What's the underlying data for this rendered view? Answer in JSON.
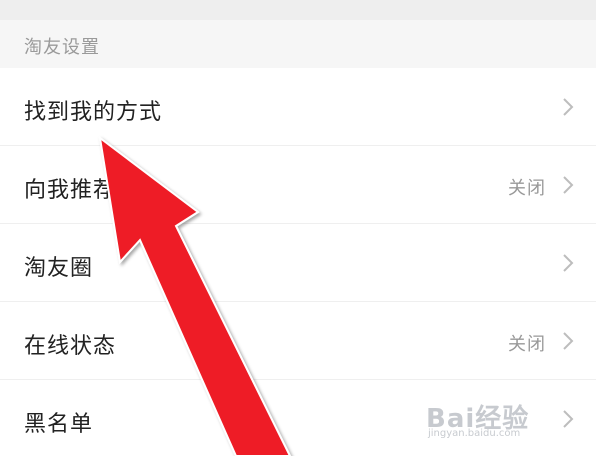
{
  "section": {
    "title": "淘友设置"
  },
  "rows": [
    {
      "label": "找到我的方式",
      "value": ""
    },
    {
      "label": "向我推荐淘友",
      "value": "关闭"
    },
    {
      "label": "淘友圈",
      "value": ""
    },
    {
      "label": "在线状态",
      "value": "关闭"
    },
    {
      "label": "黑名单",
      "value": ""
    }
  ],
  "annotation": {
    "arrow_color": "#ee1c25"
  },
  "watermark": {
    "logo_text": "Bai经验",
    "url": "jingyan.baidu.com"
  }
}
